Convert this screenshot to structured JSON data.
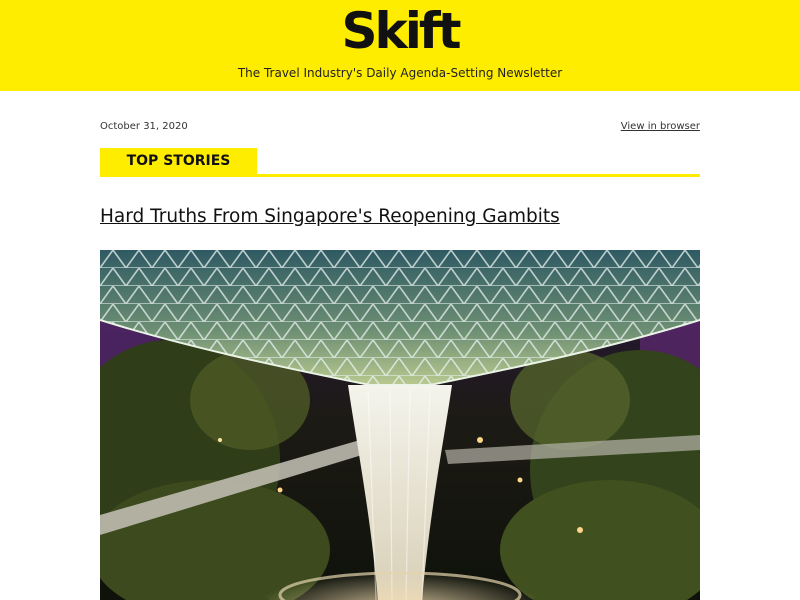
{
  "header": {
    "logo_text": "Skift",
    "tagline": "The Travel Industry's Daily Agenda-Setting Newsletter",
    "background_color": "#ffed00"
  },
  "meta": {
    "date": "October 31, 2020",
    "view_in_browser": "View in browser"
  },
  "section": {
    "label": "TOP STORIES"
  },
  "story": {
    "headline": "Hard Truths From Singapore's Reopening Gambits",
    "image_subject": "Jewel Changi Airport indoor waterfall with glass dome and forest"
  }
}
